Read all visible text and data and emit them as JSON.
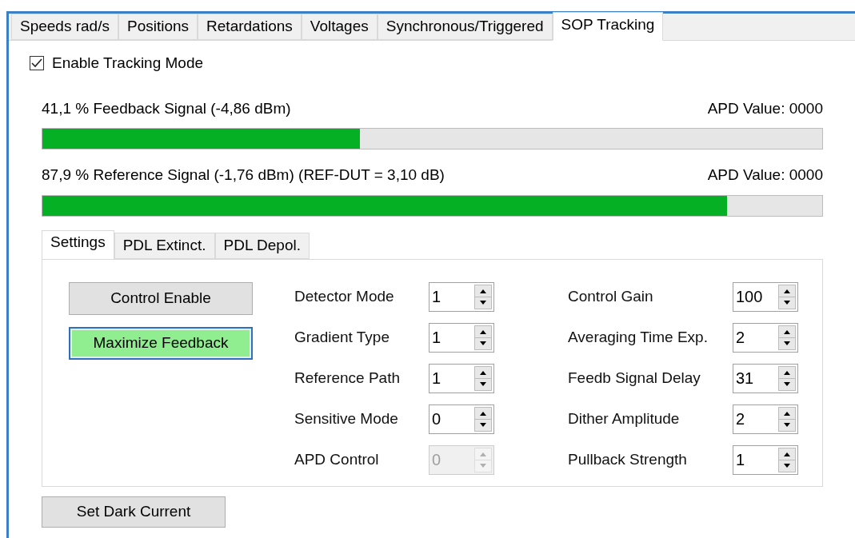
{
  "tabs": [
    {
      "label": "Speeds rad/s",
      "selected": false
    },
    {
      "label": "Positions",
      "selected": false
    },
    {
      "label": "Retardations",
      "selected": false
    },
    {
      "label": "Voltages",
      "selected": false
    },
    {
      "label": "Synchronous/Triggered",
      "selected": false
    },
    {
      "label": "SOP Tracking",
      "selected": true
    }
  ],
  "tracking_mode": {
    "label": "Enable Tracking Mode",
    "checked": true
  },
  "signals": [
    {
      "label": "41,1 % Feedback Signal (-4,86 dBm)",
      "apd": "APD Value: 0000",
      "level": 0.407
    },
    {
      "label": "87,9 % Reference Signal (-1,76 dBm) (REF-DUT = 3,10 dB)",
      "apd": "APD Value: 0000",
      "level": 0.878
    }
  ],
  "sub_tabs": [
    {
      "label": "Settings",
      "selected": true
    },
    {
      "label": "PDL Extinct.",
      "selected": false
    },
    {
      "label": "PDL Depol.",
      "selected": false
    }
  ],
  "buttons": [
    {
      "label": "Control Enable",
      "highlighted": false
    },
    {
      "label": "Maximize Feedback",
      "highlighted": true
    }
  ],
  "left_fields": [
    {
      "label": "Detector Mode",
      "value": "1",
      "disabled": false
    },
    {
      "label": "Gradient Type",
      "value": "1",
      "disabled": false
    },
    {
      "label": "Reference Path",
      "value": "1",
      "disabled": false
    },
    {
      "label": "Sensitive Mode",
      "value": "0",
      "disabled": false
    },
    {
      "label": "APD Control",
      "value": "0",
      "disabled": true
    }
  ],
  "right_fields": [
    {
      "label": "Control Gain",
      "value": "100",
      "disabled": false
    },
    {
      "label": "Averaging Time Exp.",
      "value": "2",
      "disabled": false
    },
    {
      "label": "Feedb Signal Delay",
      "value": "31",
      "disabled": false
    },
    {
      "label": "Dither Amplitude",
      "value": "2",
      "disabled": false
    },
    {
      "label": "Pullback Strength",
      "value": "1",
      "disabled": false
    }
  ],
  "dark_current_button": {
    "label": "Set Dark Current"
  }
}
